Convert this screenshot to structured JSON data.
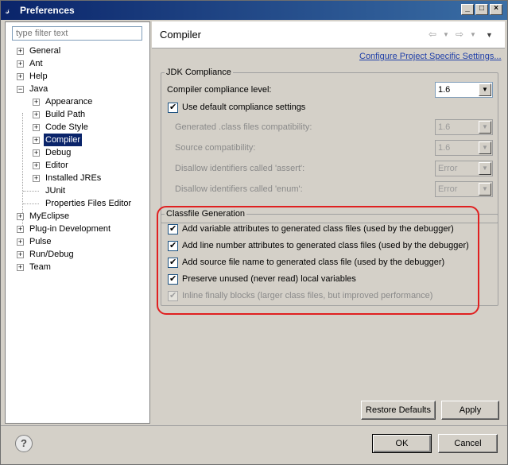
{
  "window": {
    "title": "Preferences"
  },
  "filter": {
    "placeholder": "type filter text"
  },
  "tree": [
    {
      "label": "General",
      "expander": "+"
    },
    {
      "label": "Ant",
      "expander": "+"
    },
    {
      "label": "Help",
      "expander": "+"
    },
    {
      "label": "Java",
      "expander": "−"
    },
    {
      "label": "Appearance",
      "expander": "+"
    },
    {
      "label": "Build Path",
      "expander": "+"
    },
    {
      "label": "Code Style",
      "expander": "+"
    },
    {
      "label": "Compiler",
      "expander": "+",
      "selected": true
    },
    {
      "label": "Debug",
      "expander": "+"
    },
    {
      "label": "Editor",
      "expander": "+"
    },
    {
      "label": "Installed JREs",
      "expander": "+"
    },
    {
      "label": "JUnit",
      "expander": ""
    },
    {
      "label": "Properties Files Editor",
      "expander": ""
    },
    {
      "label": "MyEclipse",
      "expander": "+"
    },
    {
      "label": "Plug-in Development",
      "expander": "+"
    },
    {
      "label": "Pulse",
      "expander": "+"
    },
    {
      "label": "Run/Debug",
      "expander": "+"
    },
    {
      "label": "Team",
      "expander": "+"
    }
  ],
  "page": {
    "title": "Compiler",
    "link": "Configure Project Specific Settings..."
  },
  "jdk": {
    "group_title": "JDK Compliance",
    "compliance_label": "Compiler compliance level:",
    "compliance_value": "1.6",
    "use_default_label": "Use default compliance settings",
    "generated_label": "Generated .class files compatibility:",
    "generated_value": "1.6",
    "source_label": "Source compatibility:",
    "source_value": "1.6",
    "assert_label": "Disallow identifiers called 'assert':",
    "assert_value": "Error",
    "enum_label": "Disallow identifiers called 'enum':",
    "enum_value": "Error"
  },
  "classfile": {
    "group_title": "Classfile Generation",
    "options": [
      {
        "label": "Add variable attributes to generated class files (used by the debugger)",
        "checked": true,
        "disabled": false
      },
      {
        "label": "Add line number attributes to generated class files (used by the debugger)",
        "checked": true,
        "disabled": false
      },
      {
        "label": "Add source file name to generated class file (used by the debugger)",
        "checked": true,
        "disabled": false
      },
      {
        "label": "Preserve unused (never read) local variables",
        "checked": true,
        "disabled": false
      },
      {
        "label": "Inline finally blocks (larger class files, but improved performance)",
        "checked": true,
        "disabled": true
      }
    ]
  },
  "buttons": {
    "restore": "Restore Defaults",
    "apply": "Apply",
    "ok": "OK",
    "cancel": "Cancel",
    "help": "?"
  },
  "colors": {
    "highlight": "#e02020",
    "selection": "#0a246a",
    "link": "#1f3fa8"
  }
}
